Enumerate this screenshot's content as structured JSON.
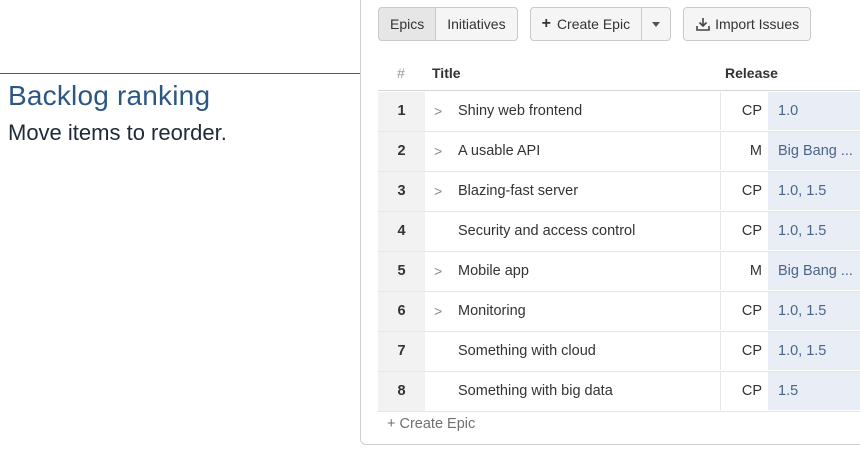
{
  "callout": {
    "title": "Backlog ranking",
    "body": "Move items to reorder."
  },
  "toolbar": {
    "tab_epics": "Epics",
    "tab_initiatives": "Initiatives",
    "create_epic_label": "Create Epic",
    "import_label": "Import Issues"
  },
  "table": {
    "col_rank": "#",
    "col_title": "Title",
    "col_release": "Release",
    "rows": [
      {
        "rank": "1",
        "expand": ">",
        "title": "Shiny web frontend",
        "code": "CP",
        "release": "1.0"
      },
      {
        "rank": "2",
        "expand": ">",
        "title": "A usable API",
        "code": "M",
        "release": "Big Bang ..."
      },
      {
        "rank": "3",
        "expand": ">",
        "title": "Blazing-fast server",
        "code": "CP",
        "release": "1.0, 1.5"
      },
      {
        "rank": "4",
        "expand": "",
        "title": "Security and access control",
        "code": "CP",
        "release": "1.0, 1.5"
      },
      {
        "rank": "5",
        "expand": ">",
        "title": "Mobile app",
        "code": "M",
        "release": "Big Bang ..."
      },
      {
        "rank": "6",
        "expand": ">",
        "title": "Monitoring",
        "code": "CP",
        "release": "1.0, 1.5"
      },
      {
        "rank": "7",
        "expand": "",
        "title": "Something with cloud",
        "code": "CP",
        "release": "1.0, 1.5"
      },
      {
        "rank": "8",
        "expand": "",
        "title": "Something with big data",
        "code": "CP",
        "release": "1.5"
      }
    ]
  },
  "footer": {
    "create_epic_link": "+ Create Epic"
  },
  "colors": {
    "callout_title": "#2c5783",
    "release_bg": "#e9eef6",
    "release_text": "#4a6488"
  },
  "icons": {
    "plus": "plus-icon",
    "caret": "chevron-down-icon",
    "import": "download-icon",
    "expand": "chevron-right-icon"
  }
}
